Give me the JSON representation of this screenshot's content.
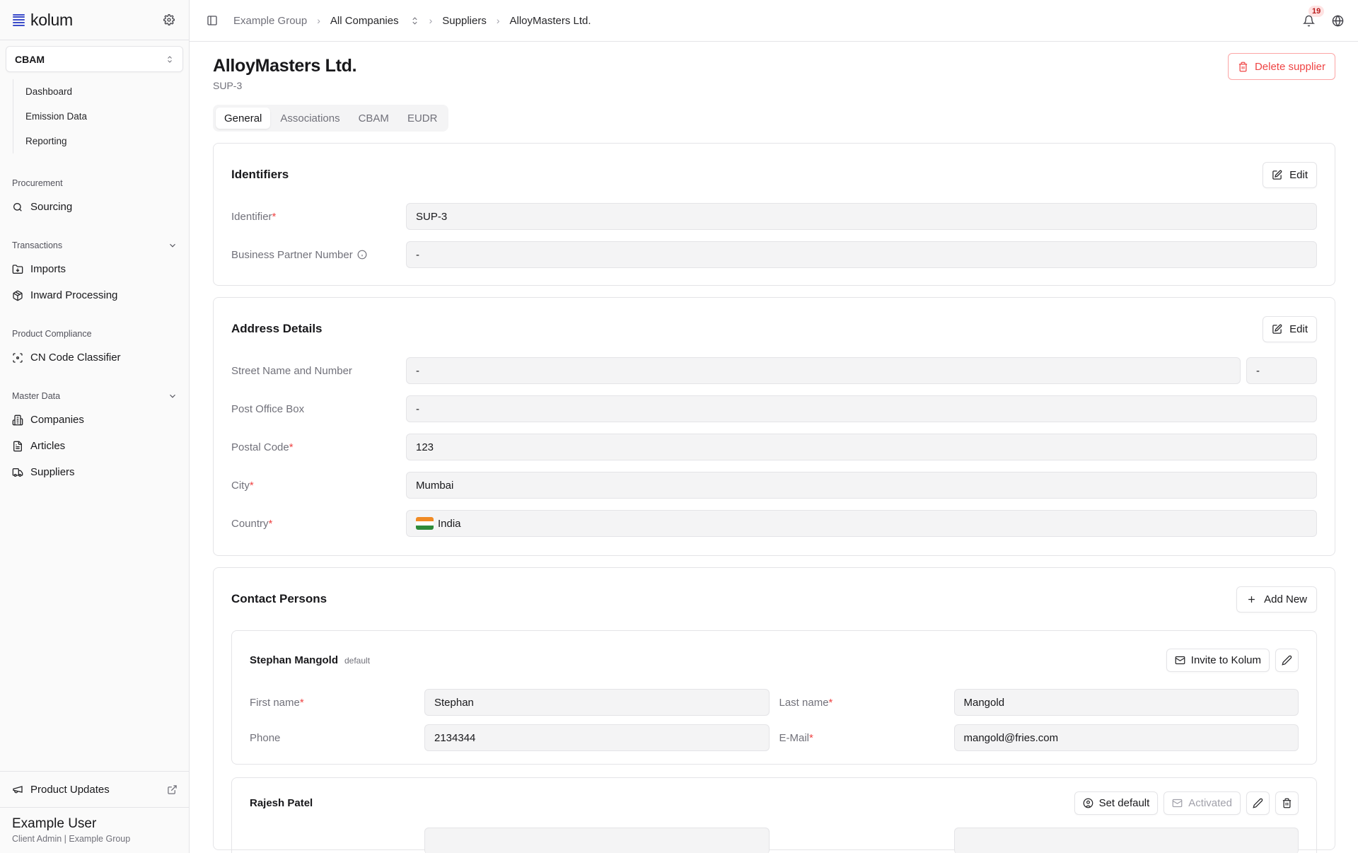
{
  "sidebar": {
    "logo_text": "kolum",
    "module": "CBAM",
    "sub_items": [
      "Dashboard",
      "Emission Data",
      "Reporting"
    ],
    "groups": {
      "procurement": {
        "label": "Procurement",
        "items": [
          "Sourcing"
        ]
      },
      "transactions": {
        "label": "Transactions",
        "items": [
          "Imports",
          "Inward Processing"
        ]
      },
      "product_compliance": {
        "label": "Product Compliance",
        "items": [
          "CN Code Classifier"
        ]
      },
      "master_data": {
        "label": "Master Data",
        "items": [
          "Companies",
          "Articles",
          "Suppliers"
        ]
      }
    },
    "product_updates": "Product Updates",
    "user": {
      "name": "Example User",
      "role": "Client Admin | Example Group"
    }
  },
  "topbar": {
    "breadcrumbs": [
      "Example Group",
      "All Companies",
      "Suppliers",
      "AlloyMasters Ltd."
    ],
    "notifications_count": "19"
  },
  "page": {
    "title": "AlloyMasters Ltd.",
    "subtitle": "SUP-3",
    "delete_label": "Delete supplier",
    "tabs": [
      "General",
      "Associations",
      "CBAM",
      "EUDR"
    ],
    "active_tab": "General"
  },
  "identifiers": {
    "title": "Identifiers",
    "edit_label": "Edit",
    "fields": [
      {
        "label": "Identifier",
        "required": "*",
        "value": "SUP-3"
      },
      {
        "label": "Business Partner Number",
        "required": "",
        "value": "-"
      }
    ]
  },
  "address": {
    "title": "Address Details",
    "edit_label": "Edit",
    "street_label": "Street Name and Number",
    "street_value": "-",
    "number_value": "-",
    "po_box_label": "Post Office Box",
    "po_box_value": "-",
    "postal_label": "Postal Code",
    "postal_value": "123",
    "city_label": "City",
    "city_value": "Mumbai",
    "country_label": "Country",
    "country_value": "India",
    "required": "*"
  },
  "contacts": {
    "title": "Contact Persons",
    "add_label": "Add New",
    "items": [
      {
        "name": "Stephan Mangold",
        "default_tag": "default",
        "invite_label": "Invite to Kolum",
        "first_name_label": "First name",
        "first_name": "Stephan",
        "last_name_label": "Last name",
        "last_name": "Mangold",
        "phone_label": "Phone",
        "phone": "2134344",
        "email_label": "E-Mail",
        "email": "mangold@fries.com"
      },
      {
        "name": "Rajesh Patel",
        "set_default_label": "Set default",
        "activated_label": "Activated"
      }
    ]
  }
}
